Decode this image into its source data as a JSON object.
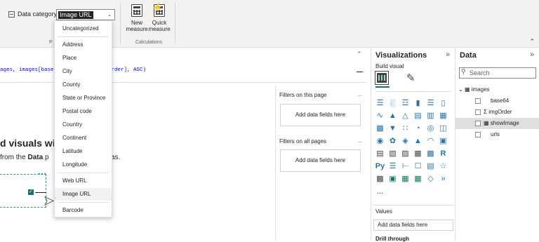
{
  "ribbon": {
    "data_category_label": "Data category",
    "data_category_value": "Image URL",
    "group_label_properties": "P",
    "new_measure_label_1": "New",
    "new_measure_label_2": "measure",
    "quick_measure_label_1": "Quick",
    "quick_measure_label_2": "measure",
    "calculations_label": "Calculations"
  },
  "dropdown": {
    "items": [
      "Uncategorized",
      "Address",
      "Place",
      "City",
      "County",
      "State or Province",
      "Postal code",
      "Country",
      "Continent",
      "Latitude",
      "Longitude",
      "Web URL",
      "Image URL",
      "Barcode"
    ],
    "highlighted": "Image URL"
  },
  "formula": {
    "text_1": "ages, images[base",
    "text_2": "rder], ASC)"
  },
  "canvas": {
    "title": "d visuals with",
    "subtitle_1": "from the",
    "subtitle_bold": "Data",
    "subtitle_2": "p",
    "subtitle_3": "rt canvas."
  },
  "filters": {
    "on_this_page": "Filters on this page",
    "on_all_pages": "Filters on all pages",
    "more": "...",
    "add_fields": "Add data fields here"
  },
  "visualizations": {
    "title": "Visualizations",
    "build_visual": "Build visual",
    "more": "...",
    "values_label": "Values",
    "add_fields": "Add data fields here",
    "drill_through": "Drill through"
  },
  "data_pane": {
    "title": "Data",
    "search_placeholder": "Search",
    "table_name": "images",
    "fields": [
      "base64",
      "imgOrder",
      "showImage",
      "urls"
    ],
    "selected_field": "showImage"
  },
  "icons": {
    "collapse": "chevron-double-right-icon",
    "caret_up": "chevron-up-icon"
  },
  "colors": {
    "accent": "#117865",
    "viz_blue": "#2474b0",
    "selection": "#e1dfdd"
  }
}
